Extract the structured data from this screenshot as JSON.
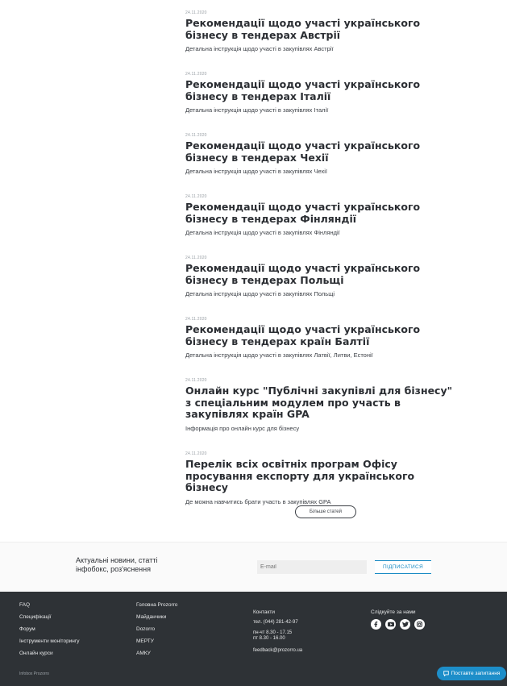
{
  "articles": [
    {
      "date": "24.11.2020",
      "title": "Рекомендації щодо участі українського бізнесу в тендерах Австрії",
      "desc": "Детальна інструкція щодо участі в закупівлях Австрії"
    },
    {
      "date": "24.11.2020",
      "title": "Рекомендації щодо участі українського бізнесу в тендерах Італії",
      "desc": "Детальна інструкція щодо участі в закупівлях Італії"
    },
    {
      "date": "24.11.2020",
      "title": "Рекомендації щодо участі українського бізнесу в тендерах Чехії",
      "desc": "Детальна інструкція щодо участі в закупівлях Чехії"
    },
    {
      "date": "24.11.2020",
      "title": "Рекомендації щодо участі українського бізнесу в тендерах Фінляндії",
      "desc": "Детальна інструкція щодо участі в закупівлях Фінляндії"
    },
    {
      "date": "24.11.2020",
      "title": "Рекомендації щодо участі українського бізнесу в тендерах Польщі",
      "desc": "Детальна інструкція щодо участі в закупівлях Польщі"
    },
    {
      "date": "24.11.2020",
      "title": "Рекомендації щодо участі українського бізнесу в тендерах країн Балтії",
      "desc": "Детальна інструкція щодо участі в закупівлях Латвії, Литви, Естонії"
    },
    {
      "date": "24.11.2020",
      "title": "Онлайн курс \"Публічні закупівлі для бізнесу\" з спеціальним модулем про участь в закупівлях країн GPA",
      "desc": "Інформація про онлайн курс для бізнесу"
    },
    {
      "date": "24.11.2020",
      "title": "Перелік всіх освітніх програм Офісу просування експорту для українського бізнесу",
      "desc": "Де можна навчитись брати участь в закупівлях GPA"
    }
  ],
  "more_button": "Більше статей",
  "subscribe": {
    "text": "Актуальні новини, статті інфобокс, роз'яснення",
    "email_placeholder": "E-mail",
    "button": "ПІДПИСАТИСЯ"
  },
  "footer": {
    "col1": [
      "FAQ",
      "Специфікації",
      "Форум",
      "Інструменти моніторингу",
      "Онлайн курси"
    ],
    "col2": [
      "Головна Prozorro",
      "Майданчики",
      "Dozorro",
      "МЕРТУ",
      "АМКУ"
    ],
    "contacts_title": "Контакти",
    "phone": "тел. (044) 281-42-97",
    "hours_1": "пн-чт 8.30 - 17.15",
    "hours_2": "пт 8.30 - 16.00",
    "email": "feedback@prozorro.ua",
    "follow_title": "Слідкуйте за нами",
    "socials": [
      "facebook-icon",
      "youtube-icon",
      "twitter-icon",
      "instagram-icon"
    ],
    "copyright": "Infobox Prozorro"
  },
  "ask_button": "Поставте запитання",
  "colors": {
    "accent": "#1d8ec9",
    "footer_bg": "#2e3236"
  }
}
